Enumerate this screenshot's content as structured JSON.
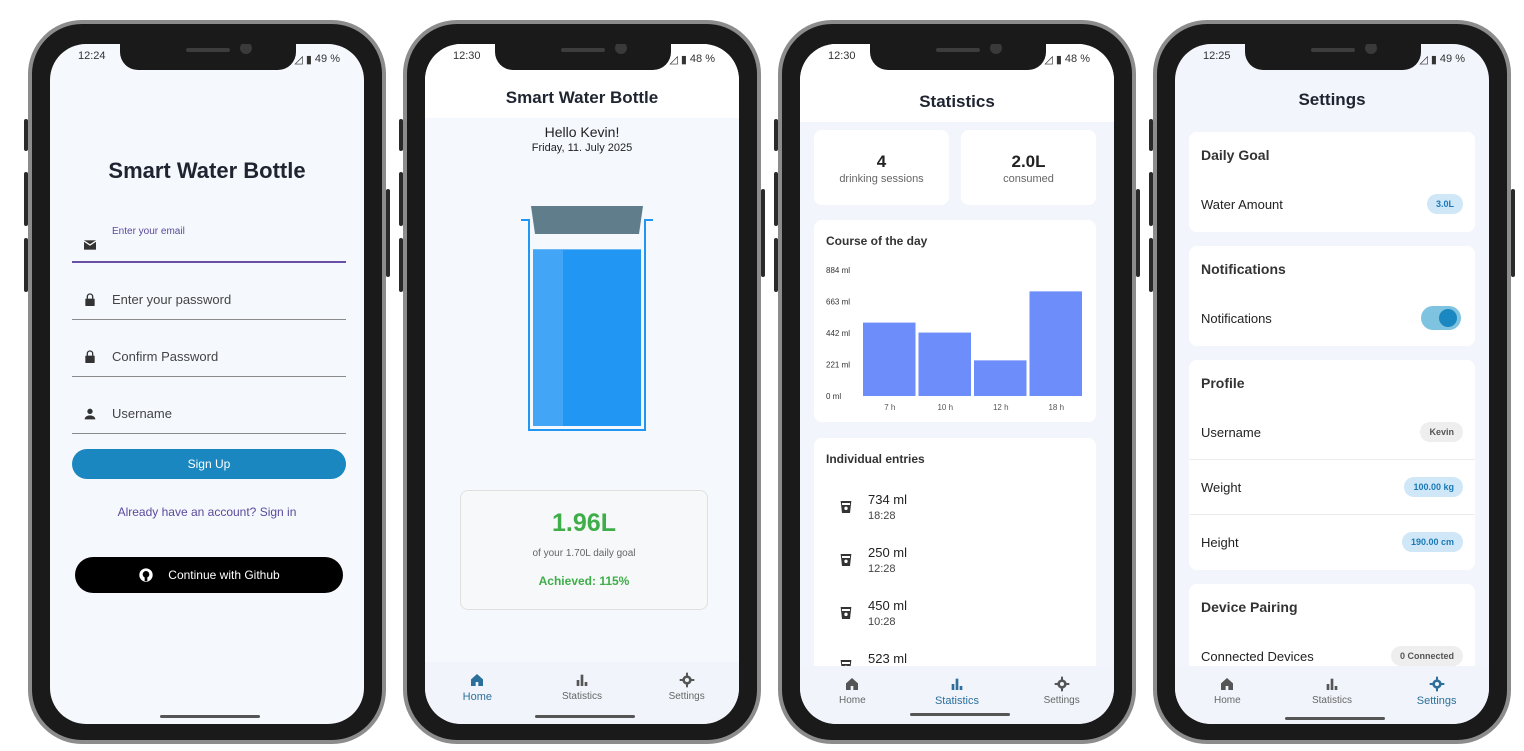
{
  "phones": {
    "login": {
      "status": {
        "time": "12:24",
        "battery": "49 %"
      },
      "title": "Smart Water Bottle",
      "email_placeholder": "Enter your email",
      "password_placeholder": "Enter your password",
      "confirm_placeholder": "Confirm Password",
      "username_placeholder": "Username",
      "signup_label": "Sign Up",
      "signin_link": "Already have an account? Sign in",
      "github_label": "Continue with Github"
    },
    "home": {
      "status": {
        "time": "12:30",
        "battery": "48 %"
      },
      "title": "Smart Water Bottle",
      "greeting": "Hello Kevin!",
      "date": "Friday, 11. July 2025",
      "fill_level": 0.92,
      "amount": "1.96L",
      "goal_text": "of your 1.70L daily goal",
      "achieved": "Achieved: 115%"
    },
    "stats": {
      "status": {
        "time": "12:30",
        "battery": "48 %"
      },
      "title": "Statistics",
      "sessions_value": "4",
      "sessions_label": "drinking sessions",
      "consumed_value": "2.0L",
      "consumed_label": "consumed",
      "chart_title": "Course of the day",
      "entries_title": "Individual entries",
      "entries": [
        {
          "amount": "734 ml",
          "time": "18:28"
        },
        {
          "amount": "250 ml",
          "time": "12:28"
        },
        {
          "amount": "450 ml",
          "time": "10:28"
        },
        {
          "amount": "523 ml",
          "time": ""
        }
      ]
    },
    "settings": {
      "status": {
        "time": "12:25",
        "battery": "49 %"
      },
      "title": "Settings",
      "daily_goal_title": "Daily Goal",
      "water_amount_label": "Water Amount",
      "water_amount_value": "3.0L",
      "notifications_title": "Notifications",
      "notifications_label": "Notifications",
      "notifications_on": true,
      "profile_title": "Profile",
      "username_label": "Username",
      "username_value": "Kevin",
      "weight_label": "Weight",
      "weight_value": "100.00 kg",
      "height_label": "Height",
      "height_value": "190.00 cm",
      "device_title": "Device Pairing",
      "connected_label": "Connected Devices",
      "connected_value": "0 Connected"
    }
  },
  "nav": {
    "home": "Home",
    "statistics": "Statistics",
    "settings": "Settings"
  },
  "colors": {
    "primary": "#1a87c0",
    "bar": "#6c8dfa",
    "accent_green": "#3fae4a",
    "water": "#2196f3",
    "lid": "#607d8b",
    "signin": "#5a4a9c"
  },
  "chart_data": {
    "type": "bar",
    "categories": [
      "7 h",
      "10 h",
      "12 h",
      "18 h"
    ],
    "values": [
      515,
      445,
      250,
      734
    ],
    "yticks": [
      "884 ml",
      "663 ml",
      "442 ml",
      "221 ml",
      "0 ml"
    ],
    "ylim": [
      0,
      884
    ],
    "grid": false
  }
}
